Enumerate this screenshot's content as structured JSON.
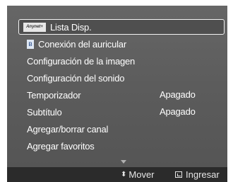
{
  "menu": {
    "items": [
      {
        "label": "Lista Disp.",
        "icon": "anynet-logo-icon",
        "icon_text": "Anynet+",
        "selected": true
      },
      {
        "label": "Conexión del auricular",
        "icon": "bluetooth-icon",
        "icon_text": "ʙ"
      },
      {
        "label": "Configuración de la imagen"
      },
      {
        "label": "Configuración del sonido"
      },
      {
        "label": "Temporizador",
        "value": "Apagado"
      },
      {
        "label": "Subtítulo",
        "value": "Apagado"
      },
      {
        "label": "Agregar/borrar canal"
      },
      {
        "label": "Agregar favoritos"
      }
    ]
  },
  "footer": {
    "move_icon": "up-down-arrows-icon",
    "move_icon_glyph": "⬍",
    "move_label": "Mover",
    "enter_icon": "enter-icon",
    "enter_label": "Ingresar"
  },
  "colors": {
    "panel": "#5c5c5c",
    "bottom_bar": "#2b2b2b",
    "text": "#ffffff",
    "selection_border": "#f2f2f2"
  }
}
